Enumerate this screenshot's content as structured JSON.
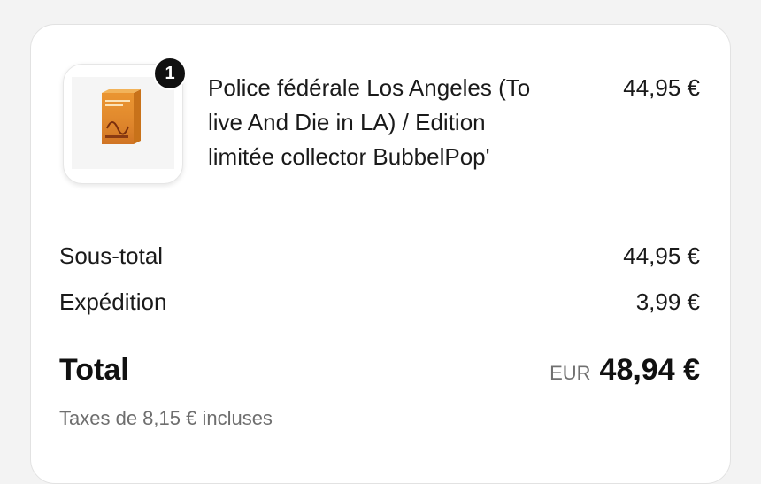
{
  "cart": {
    "item": {
      "quantity": "1",
      "title_line1": "Police fédérale Los Angeles (To",
      "title_line2": "live And Die in LA) / Edition",
      "title_line3": "limitée collector BubbelPop'",
      "price": "44,95 €",
      "image_icon": "bluray-box-cover"
    },
    "subtotal": {
      "label": "Sous-total",
      "value": "44,95 €"
    },
    "shipping": {
      "label": "Expédition",
      "value": "3,99 €"
    },
    "total": {
      "label": "Total",
      "currency": "EUR",
      "value": "48,94 €"
    },
    "taxes_note": "Taxes de 8,15 € incluses"
  },
  "colors": {
    "page_background": "#f3f3f3",
    "card_background": "#ffffff",
    "text_primary": "#1a1a1a",
    "text_muted": "#6e6e6e",
    "badge_background": "#111111",
    "cover_orange": "#e8912d"
  }
}
